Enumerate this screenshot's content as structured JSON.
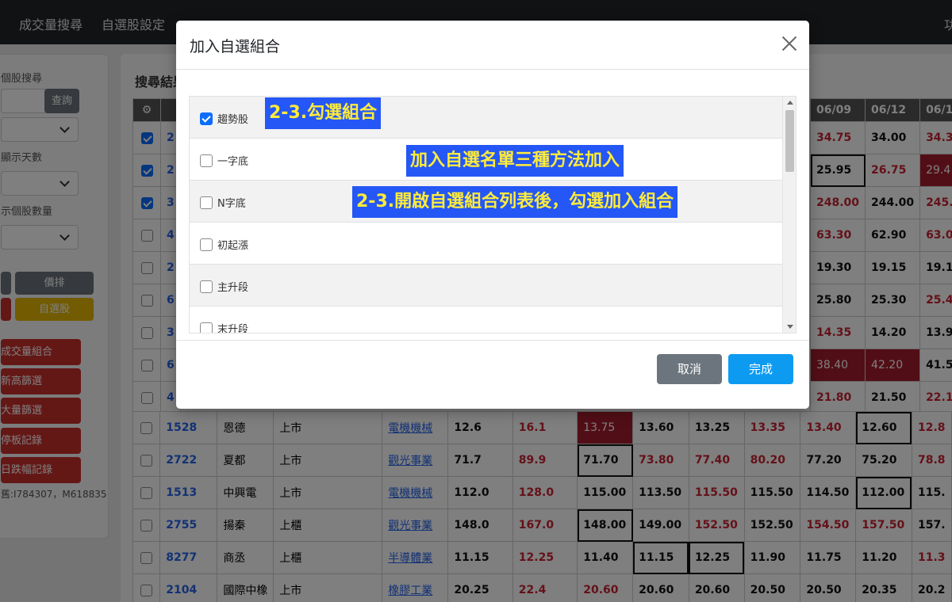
{
  "nav": {
    "items": [
      "成交量搜尋",
      "自選股設定"
    ],
    "right_label": "功"
  },
  "sidebar": {
    "label_search": "個股搜尋",
    "query_button": "查詢",
    "label_days": "顯示天數",
    "label_count": "示個股數量",
    "btn_sort": "價排",
    "btn_watchlist": "自選股",
    "red_buttons": [
      "成交量組合",
      "新高篩選",
      "大量篩選",
      "停板記錄",
      "日跌幅記錄"
    ],
    "footer_text": "舊:I784307，M618835"
  },
  "main": {
    "title": "搜尋結果",
    "date_headers": [
      "06/09",
      "06/12",
      "06/1"
    ],
    "upper_rows": [
      {
        "checked": true,
        "code": "2",
        "d1": {
          "v": "34.75",
          "cls": "up"
        },
        "d2": {
          "v": "34.00",
          "cls": "num"
        },
        "d3": {
          "v": "34.3",
          "cls": "up"
        }
      },
      {
        "checked": true,
        "code": "2",
        "d1": {
          "v": "25.95",
          "cls": "num boxed"
        },
        "d2": {
          "v": "26.75",
          "cls": "up"
        },
        "d3": {
          "v": "29.4",
          "cls": "hl"
        }
      },
      {
        "checked": true,
        "code": "3",
        "d1": {
          "v": "248.00",
          "cls": "up"
        },
        "d2": {
          "v": "244.00",
          "cls": "num"
        },
        "d3": {
          "v": "245.",
          "cls": "up"
        }
      },
      {
        "checked": false,
        "code": "4",
        "d1": {
          "v": "63.30",
          "cls": "up"
        },
        "d2": {
          "v": "62.90",
          "cls": "num"
        },
        "d3": {
          "v": "63.0",
          "cls": "up"
        }
      },
      {
        "checked": false,
        "code": "2",
        "d1": {
          "v": "19.30",
          "cls": "num"
        },
        "d2": {
          "v": "19.15",
          "cls": "num"
        },
        "d3": {
          "v": "19.1",
          "cls": "num"
        }
      },
      {
        "checked": false,
        "code": "6",
        "d1": {
          "v": "25.80",
          "cls": "num"
        },
        "d2": {
          "v": "25.30",
          "cls": "num"
        },
        "d3": {
          "v": "25.4",
          "cls": "up"
        }
      },
      {
        "checked": false,
        "code": "3",
        "d1": {
          "v": "14.35",
          "cls": "up"
        },
        "d2": {
          "v": "14.20",
          "cls": "num"
        },
        "d3": {
          "v": "13.9",
          "cls": "num"
        }
      },
      {
        "checked": false,
        "code": "6",
        "d1": {
          "v": "38.40",
          "cls": "hl"
        },
        "d2": {
          "v": "42.20",
          "cls": "hl"
        },
        "d3": {
          "v": "41.5",
          "cls": "num"
        }
      },
      {
        "checked": false,
        "code": "4",
        "d1": {
          "v": "21.80",
          "cls": "up"
        },
        "d2": {
          "v": "21.50",
          "cls": "num"
        },
        "d3": {
          "v": "22.1",
          "cls": "up"
        }
      }
    ],
    "rows": [
      {
        "code": "1528",
        "name": "恩德",
        "market": "上市",
        "sector": "電機機械",
        "cells": [
          [
            "12.6",
            "num"
          ],
          [
            "16.1",
            "up"
          ],
          [
            "13.75",
            "hl"
          ],
          [
            "13.60",
            "num"
          ],
          [
            "13.25",
            "num"
          ],
          [
            "13.35",
            "up"
          ],
          [
            "13.40",
            "up"
          ],
          [
            "12.60",
            "num boxed"
          ],
          [
            "12.8",
            "up"
          ]
        ]
      },
      {
        "code": "2722",
        "name": "夏都",
        "market": "上市",
        "sector": "觀光事業",
        "cells": [
          [
            "71.7",
            "num"
          ],
          [
            "89.9",
            "up"
          ],
          [
            "71.70",
            "num boxed"
          ],
          [
            "73.80",
            "up"
          ],
          [
            "77.40",
            "up"
          ],
          [
            "80.20",
            "up"
          ],
          [
            "77.20",
            "num"
          ],
          [
            "75.20",
            "num"
          ],
          [
            "78.8",
            "up"
          ]
        ]
      },
      {
        "code": "1513",
        "name": "中興電",
        "market": "上市",
        "sector": "電機機械",
        "cells": [
          [
            "112.0",
            "num"
          ],
          [
            "128.0",
            "up"
          ],
          [
            "115.00",
            "num"
          ],
          [
            "113.50",
            "num"
          ],
          [
            "115.50",
            "up"
          ],
          [
            "115.50",
            "num"
          ],
          [
            "114.50",
            "num"
          ],
          [
            "112.00",
            "num boxed"
          ],
          [
            "115.",
            "num"
          ]
        ]
      },
      {
        "code": "2755",
        "name": "揚秦",
        "market": "上櫃",
        "sector": "觀光事業",
        "cells": [
          [
            "148.0",
            "num"
          ],
          [
            "167.0",
            "up"
          ],
          [
            "148.00",
            "num boxed"
          ],
          [
            "149.00",
            "num"
          ],
          [
            "152.50",
            "up"
          ],
          [
            "152.50",
            "num"
          ],
          [
            "154.50",
            "up"
          ],
          [
            "157.50",
            "up"
          ],
          [
            "157.",
            "num"
          ]
        ]
      },
      {
        "code": "8277",
        "name": "商丞",
        "market": "上櫃",
        "sector": "半導體業",
        "cells": [
          [
            "11.15",
            "num"
          ],
          [
            "12.25",
            "up"
          ],
          [
            "11.40",
            "num"
          ],
          [
            "11.15",
            "num boxed"
          ],
          [
            "12.25",
            "num boxed"
          ],
          [
            "11.90",
            "num"
          ],
          [
            "11.75",
            "num"
          ],
          [
            "11.20",
            "num"
          ],
          [
            "11.3",
            "up"
          ]
        ]
      },
      {
        "code": "2104",
        "name": "國際中橡",
        "market": "上市",
        "sector": "橡膠工業",
        "cells": [
          [
            "20.25",
            "num"
          ],
          [
            "22.4",
            "up"
          ],
          [
            "20.60",
            "up"
          ],
          [
            "20.60",
            "num"
          ],
          [
            "20.60",
            "num"
          ],
          [
            "20.50",
            "num"
          ],
          [
            "20.50",
            "num"
          ],
          [
            "20.35",
            "num"
          ],
          [
            "20.2",
            "num"
          ]
        ]
      }
    ]
  },
  "modal": {
    "title": "加入自選組合",
    "items": [
      {
        "label": "趨勢股",
        "checked": true
      },
      {
        "label": "一字底",
        "checked": false
      },
      {
        "label": "N字底",
        "checked": false
      },
      {
        "label": "初起漲",
        "checked": false
      },
      {
        "label": "主升段",
        "checked": false
      },
      {
        "label": "末升段",
        "checked": false
      }
    ],
    "annotations": [
      "2-3.勾選組合",
      "加入自選名單三種方法加入",
      "2-3.開啟自選組合列表後，勾選加入組合"
    ],
    "cancel_label": "取消",
    "done_label": "完成"
  }
}
